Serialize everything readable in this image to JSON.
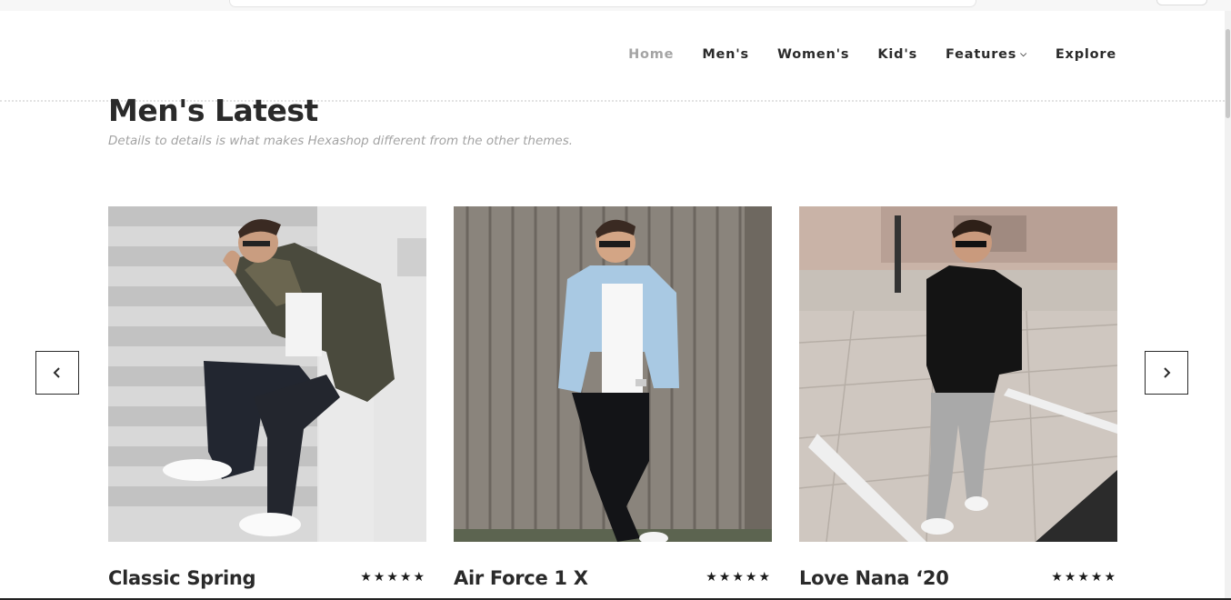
{
  "nav": {
    "items": [
      {
        "label": "Home",
        "active": true
      },
      {
        "label": "Men's",
        "active": false
      },
      {
        "label": "Women's",
        "active": false
      },
      {
        "label": "Kid's",
        "active": false
      },
      {
        "label": "Features",
        "active": false,
        "dropdown": true
      },
      {
        "label": "Explore",
        "active": false
      }
    ]
  },
  "section": {
    "title": "Men's Latest",
    "subtitle": "Details to details is what makes Hexashop different from the other themes."
  },
  "carousel": {
    "prev_icon": "chevron-left-icon",
    "next_icon": "chevron-right-icon",
    "products": [
      {
        "name": "Classic Spring",
        "rating": "★★★★★"
      },
      {
        "name": "Air Force 1 X",
        "rating": "★★★★★"
      },
      {
        "name": "Love Nana ‘20",
        "rating": "★★★★★"
      }
    ]
  },
  "colors": {
    "text": "#2a2a2a",
    "nav_active": "#a4a4a4",
    "subtitle": "#a3a3a3"
  }
}
